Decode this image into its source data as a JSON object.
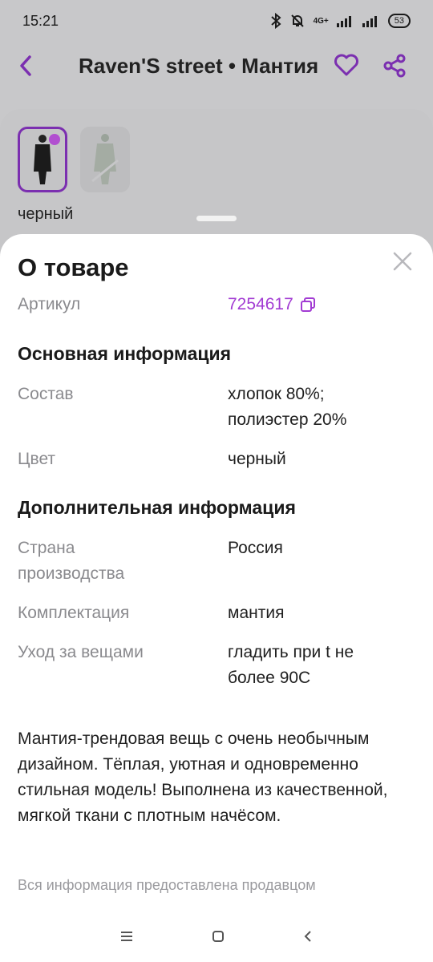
{
  "status_bar": {
    "time": "15:21",
    "network": "4G+",
    "battery": "53"
  },
  "app_bar": {
    "title": "Raven'S street • Мантия",
    "icons": [
      "back-arrow-icon",
      "heart-icon",
      "share-icon"
    ]
  },
  "product": {
    "color_label": "черный",
    "thumbnails": [
      {
        "selected": true
      },
      {
        "selected": false
      }
    ]
  },
  "sheet": {
    "title": "О товаре",
    "article_label": "Артикул",
    "article_value": "7254617",
    "main_section": "Основная информация",
    "composition_label": "Состав",
    "composition_value_1": "хлопок 80%;",
    "composition_value_2": "полиэстер 20%",
    "color_label": "Цвет",
    "color_value": "черный",
    "extra_section": "Дополнительная информация",
    "country_label_1": "Страна",
    "country_label_2": "производства",
    "country_value": "Россия",
    "set_label": "Комплектация",
    "set_value": "мантия",
    "care_label": "Уход за вещами",
    "care_value_1": "гладить при t не",
    "care_value_2": "более 90С",
    "description": "Мантия-трендовая вещь с очень необычным дизайном. Тёплая, уютная и одновременно стильная модель! Выполнена из качественной, мягкой ткани с плотным начёсом.",
    "footnote": "Вся информация предоставлена продавцом"
  },
  "colors": {
    "accent": "#7b2fb0",
    "link": "#a23bd3"
  }
}
